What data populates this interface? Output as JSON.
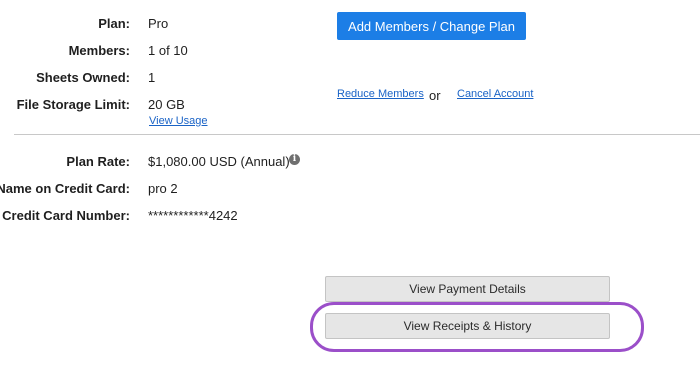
{
  "account": {
    "plan_label": "Plan:",
    "plan_value": "Pro",
    "members_label": "Members:",
    "members_value": "1 of 10",
    "sheets_label": "Sheets Owned:",
    "sheets_value": "1",
    "storage_label": "File Storage Limit:",
    "storage_value": "20 GB",
    "view_usage_link": "View Usage"
  },
  "actions": {
    "add_members_button": "Add Members / Change Plan",
    "reduce_members_link": "Reduce Members",
    "or_text": "or",
    "cancel_account_link": "Cancel Account"
  },
  "billing": {
    "rate_label": "Plan Rate:",
    "rate_value": "$1,080.00 USD (Annual)",
    "info_icon": "info-icon",
    "info_glyph": "i",
    "name_label": "Name on Credit Card:",
    "name_value": "pro 2",
    "card_label": "Credit Card Number:",
    "card_value": "************4242"
  },
  "buttons": {
    "payment_details": "View Payment Details",
    "receipts_history": "View Receipts & History"
  },
  "colors": {
    "primary": "#1c7ee6",
    "link": "#1a63c6",
    "highlight": "#9b4fc9"
  }
}
